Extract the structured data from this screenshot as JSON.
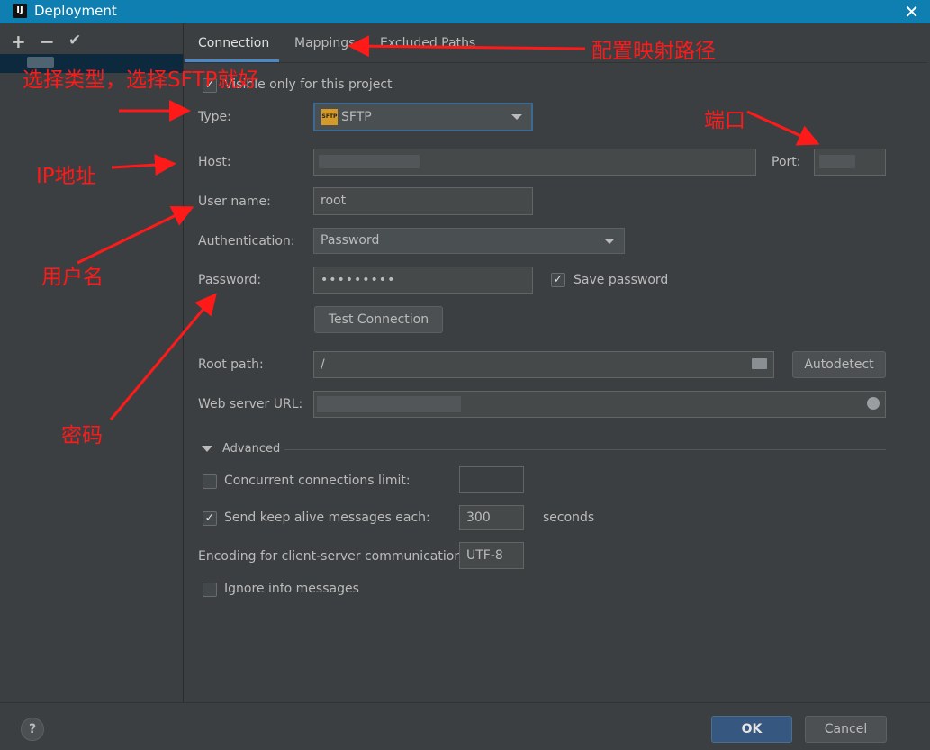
{
  "window": {
    "title": "Deployment",
    "logo": "IJ",
    "close_glyph": "✕"
  },
  "sidebar": {
    "add": "+",
    "remove": "−",
    "apply": "✔"
  },
  "tabs": [
    {
      "label": "Connection",
      "active": true
    },
    {
      "label": "Mappings",
      "active": false
    },
    {
      "label": "Excluded Paths",
      "active": false
    }
  ],
  "form": {
    "visible_only": {
      "label": "Visible only for this project",
      "checked": true
    },
    "type": {
      "label": "Type:",
      "value": "SFTP",
      "icon": "SFTP"
    },
    "host": {
      "label": "Host:",
      "value": ""
    },
    "port": {
      "label": "Port:",
      "value": ""
    },
    "username": {
      "label": "User name:",
      "value": "root"
    },
    "authentication": {
      "label": "Authentication:",
      "value": "Password"
    },
    "password": {
      "label": "Password:",
      "value": "•••••••••"
    },
    "save_password": {
      "label": "Save password",
      "checked": true
    },
    "test_connection": "Test Connection",
    "root_path": {
      "label": "Root path:",
      "value": "/"
    },
    "autodetect": "Autodetect",
    "web_server_url": {
      "label": "Web server URL:",
      "value": ""
    },
    "advanced": {
      "label": "Advanced",
      "expanded": true
    },
    "concurrent_limit": {
      "label": "Concurrent connections limit:",
      "checked": false,
      "value": ""
    },
    "keep_alive": {
      "label": "Send keep alive messages each:",
      "checked": true,
      "value": "300",
      "unit": "seconds"
    },
    "encoding": {
      "label": "Encoding for client-server communication:",
      "value": "UTF-8"
    },
    "ignore_info": {
      "label": "Ignore info messages",
      "checked": false
    }
  },
  "footer": {
    "help": "?",
    "ok": "OK",
    "cancel": "Cancel"
  },
  "annotations": {
    "type_note": "选择类型，选择SFTP就好",
    "mapping_note": "配置映射路径",
    "port_note": "端口",
    "ip_note": "IP地址",
    "user_note": "用户名",
    "password_note": "密码"
  },
  "colors": {
    "accent": "#365880",
    "annotation": "#ff1a1a",
    "background": "#3c3f41",
    "titlebar": "#0e7fb0"
  }
}
